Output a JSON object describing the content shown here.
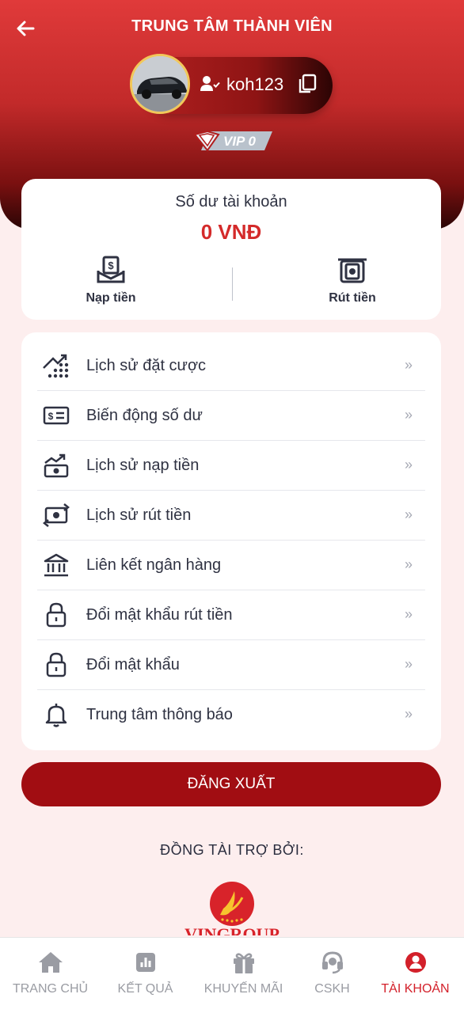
{
  "header": {
    "title": "TRUNG TÂM THÀNH VIÊN"
  },
  "user": {
    "username": "koh123",
    "vip_label": "VIP 0"
  },
  "balance": {
    "label": "Số dư tài khoản",
    "value": "0 VNĐ"
  },
  "actions": {
    "deposit": "Nạp tiền",
    "withdraw": "Rút tiền"
  },
  "menu": {
    "items": [
      {
        "label": "Lịch sử đặt cược",
        "icon": "chart-dots-icon"
      },
      {
        "label": "Biến động số dư",
        "icon": "money-card-icon"
      },
      {
        "label": "Lịch sử nạp tiền",
        "icon": "deposit-history-icon"
      },
      {
        "label": "Lịch sử rút tiền",
        "icon": "withdraw-history-icon"
      },
      {
        "label": "Liên kết ngân hàng",
        "icon": "bank-icon"
      },
      {
        "label": "Đổi mật khẩu rút tiền",
        "icon": "lock-icon"
      },
      {
        "label": "Đổi mật khẩu",
        "icon": "lock-icon"
      },
      {
        "label": "Trung tâm thông báo",
        "icon": "bell-icon"
      }
    ],
    "arrow": "»"
  },
  "logout": {
    "label": "ĐĂNG XUẤT"
  },
  "sponsor": {
    "title": "ĐỒNG TÀI TRỢ BỞI:",
    "logo_text": "VINGROUP"
  },
  "tabs": [
    {
      "label": "TRANG CHỦ",
      "icon": "home-icon"
    },
    {
      "label": "KẾT QUẢ",
      "icon": "results-icon"
    },
    {
      "label": "KHUYẾN MÃI",
      "icon": "gift-icon"
    },
    {
      "label": "CSKH",
      "icon": "headset-icon"
    },
    {
      "label": "TÀI KHOẢN",
      "icon": "account-icon"
    }
  ],
  "colors": {
    "accent": "#d3202a",
    "logout_bg": "#a10d12",
    "inactive": "#9a9ca3"
  }
}
